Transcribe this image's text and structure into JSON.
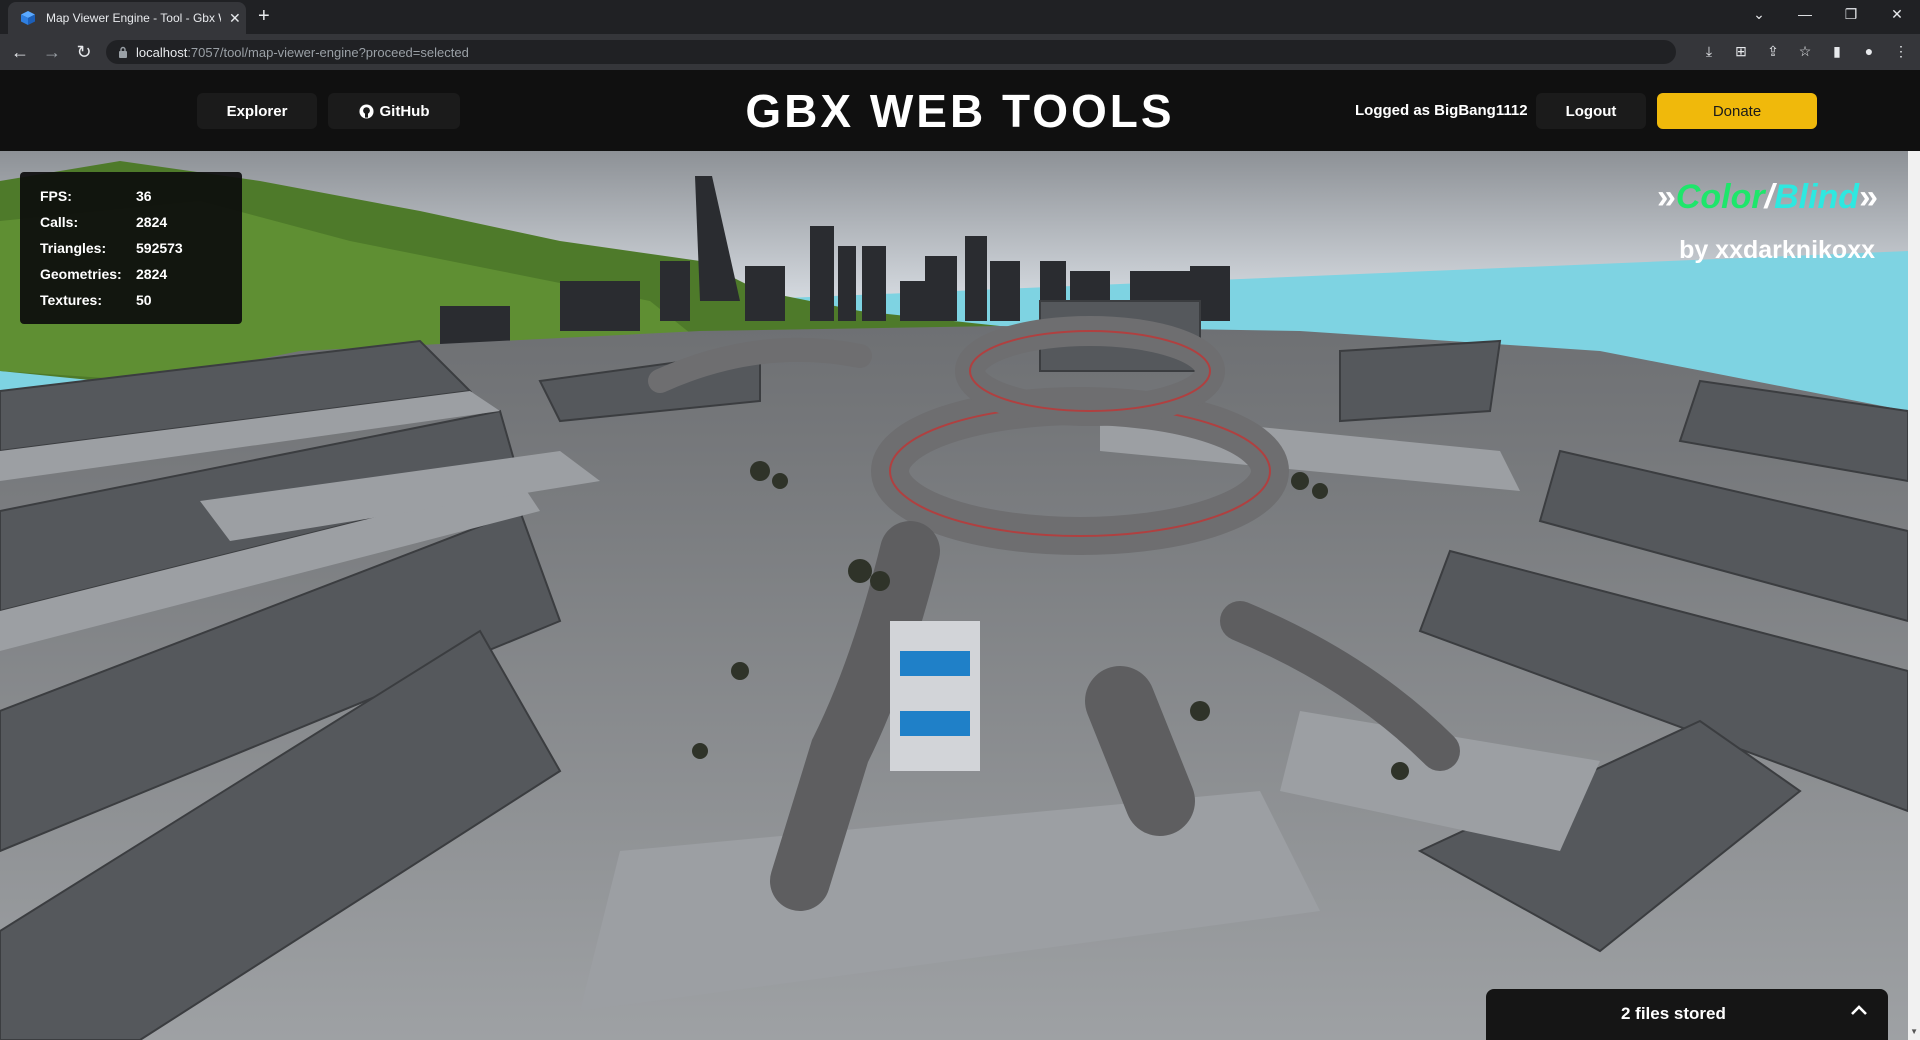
{
  "browser": {
    "tab_title": "Map Viewer Engine - Tool - Gbx Web Tools",
    "url_host": "localhost",
    "url_rest": ":7057/tool/map-viewer-engine?proceed=selected"
  },
  "header": {
    "explorer_label": "Explorer",
    "github_label": "GitHub",
    "title": "GBX WEB TOOLS",
    "logged_text": "Logged as BigBang1112",
    "logout_label": "Logout",
    "donate_label": "Donate"
  },
  "stats": [
    {
      "label": "FPS:",
      "value": "36"
    },
    {
      "label": "Calls:",
      "value": "2824"
    },
    {
      "label": "Triangles:",
      "value": "592573"
    },
    {
      "label": "Geometries:",
      "value": "2824"
    },
    {
      "label": "Textures:",
      "value": "50"
    }
  ],
  "map": {
    "name_part1": "Color",
    "separator": "/",
    "name_part2": "Blind",
    "chevrons": "»",
    "author": "by xxdarknikoxx"
  },
  "files_panel": {
    "label": "2 files stored"
  },
  "colors": {
    "donate": "#f0b90b",
    "map_green": "#1ee66b",
    "map_cyan": "#2ee8e0",
    "header_bg": "#101010"
  }
}
